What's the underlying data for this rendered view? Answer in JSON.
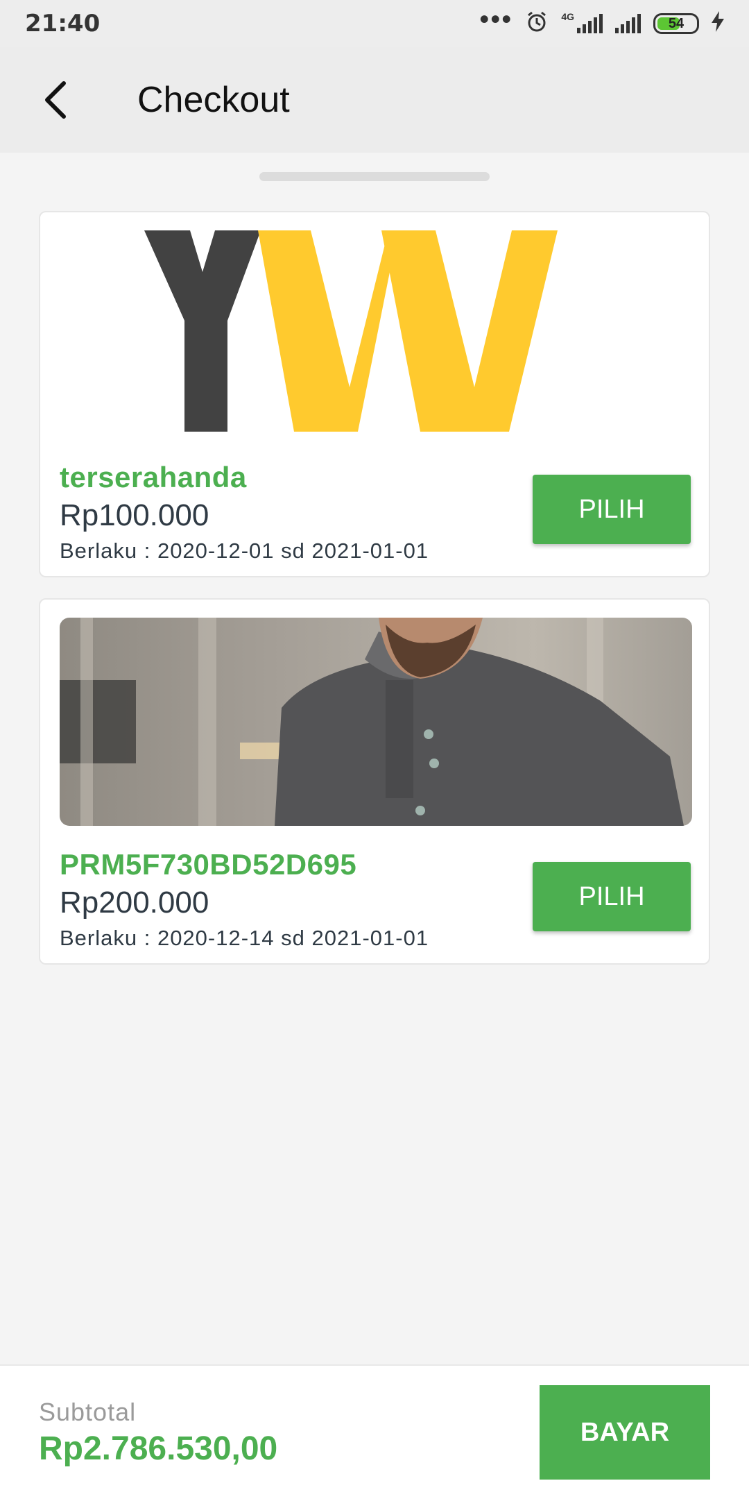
{
  "status_bar": {
    "time": "21:40",
    "network_type": "4G",
    "battery_level": "54",
    "icons": [
      "more-dots-icon",
      "alarm-icon",
      "signal-icon",
      "battery-icon",
      "charging-icon"
    ]
  },
  "header": {
    "title": "Checkout",
    "back_icon": "back-arrow-icon"
  },
  "promos": [
    {
      "image": "yvv-logo-image",
      "code": "terserahanda",
      "price": "Rp100.000",
      "validity": "Berlaku : 2020-12-01 sd 2021-01-01",
      "button_label": "PILIH"
    },
    {
      "image": "man-in-shirt-photo",
      "code": "PRM5F730BD52D695",
      "price": "Rp200.000",
      "validity": "Berlaku : 2020-12-14 sd 2021-01-01",
      "button_label": "PILIH"
    }
  ],
  "footer": {
    "subtotal_label": "Subtotal",
    "subtotal_value": "Rp2.786.530,00",
    "pay_button_label": "BAYAR"
  },
  "colors": {
    "accent": "#4caf50",
    "text_dark": "#2f3a44",
    "background": "#f4f4f4"
  }
}
